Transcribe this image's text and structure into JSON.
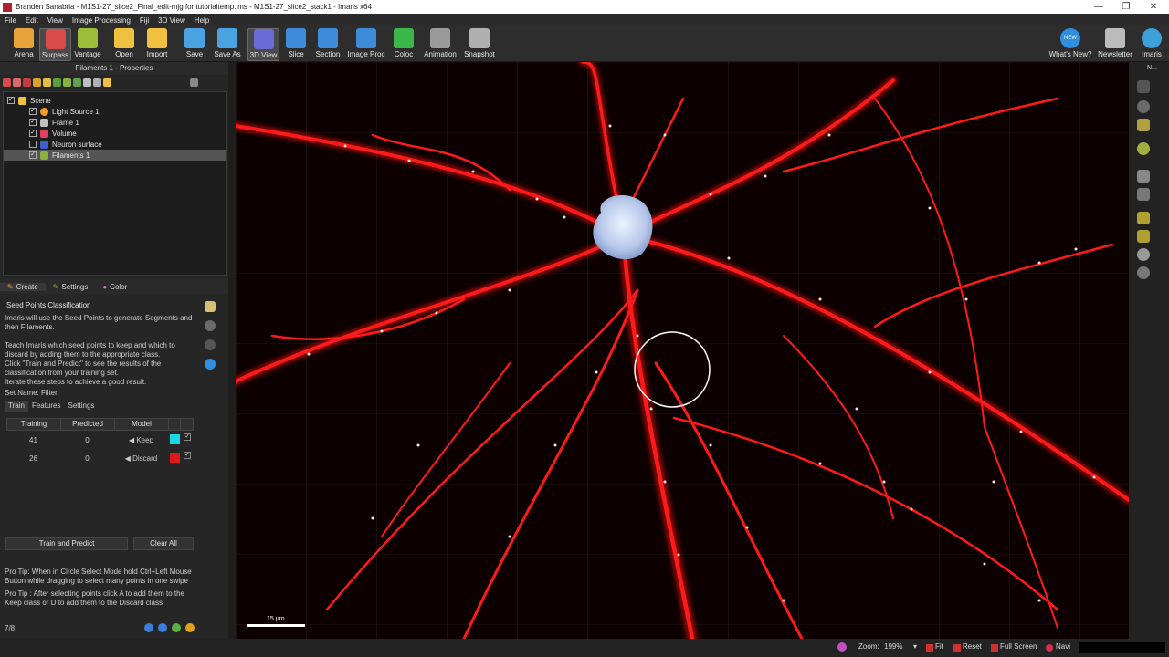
{
  "window": {
    "title": "Branden Sanabria - M1S1-27_slice2_Final_edit-mjg for tutorialtemp.ims - M1S1-27_slice2_stack1 - Imaris x64",
    "minimize": "—",
    "restore": "❐",
    "close": "✕"
  },
  "menu": [
    "File",
    "Edit",
    "View",
    "Image Processing",
    "Fiji",
    "3D View",
    "Help"
  ],
  "toolbar": {
    "left": [
      {
        "label": "Arena",
        "color": "#e8a23a"
      },
      {
        "label": "Surpass",
        "color": "#d94b4b"
      },
      {
        "label": "Vantage",
        "color": "#9bbd3a"
      },
      {
        "label": "Open",
        "color": "#f0c040"
      },
      {
        "label": "Import",
        "color": "#f0c040"
      },
      {
        "label": "Save",
        "color": "#4aa3e0"
      },
      {
        "label": "Save As",
        "color": "#4aa3e0"
      },
      {
        "label": "3D View",
        "color": "#6b6bd8"
      },
      {
        "label": "Slice",
        "color": "#3d8ad8"
      },
      {
        "label": "Section",
        "color": "#3d8ad8"
      },
      {
        "label": "Image Proc",
        "color": "#3d8ad8"
      },
      {
        "label": "Coloc",
        "color": "#3cb84a"
      },
      {
        "label": "Animation",
        "color": "#9a9a9a"
      },
      {
        "label": "Snapshot",
        "color": "#b0b0b0"
      }
    ],
    "right": [
      {
        "label": "What's New?",
        "color": "#2f8fe0"
      },
      {
        "label": "Newsletter",
        "color": "#bbbbbb"
      },
      {
        "label": "Imaris",
        "color": "#3da0d8"
      }
    ],
    "new_badge": "NEW"
  },
  "properties_panel": {
    "title": "Filaments 1 - Properties",
    "tree": [
      {
        "label": "Scene",
        "checked": true,
        "icon_color": "#f0c040",
        "indent": 0
      },
      {
        "label": "Light Source 1",
        "checked": true,
        "icon_color": "#f0a020",
        "indent": 1
      },
      {
        "label": "Frame 1",
        "checked": true,
        "icon_color": "#c0c0c0",
        "indent": 1
      },
      {
        "label": "Volume",
        "checked": true,
        "icon_color": "#e04060",
        "indent": 1
      },
      {
        "label": "Neuron surface",
        "checked": false,
        "icon_color": "#4060d0",
        "indent": 1
      },
      {
        "label": "Filaments 1",
        "checked": true,
        "icon_color": "#8ab040",
        "indent": 1,
        "selected": true
      }
    ],
    "tabs": [
      "Create",
      "Settings",
      "Color"
    ],
    "section_title": "Seed Points Classification",
    "intro": "Imaris will use the Seed Points to generate Segments and then Filaments.",
    "instructions": [
      "Teach Imaris which seed points to keep and which to",
      "discard by adding them to the appropriate class.",
      "Click \"Train and Predict\" to see the results of the",
      "classification from your training set.",
      "Iterate these steps to achieve a good result."
    ],
    "set_name": "Set Name: Filter",
    "subtabs": [
      "Train",
      "Features",
      "Settings"
    ],
    "table": {
      "headers": [
        "Training",
        "Predicted",
        "Model"
      ],
      "rows": [
        {
          "training": "41",
          "predicted": "0",
          "model": "Keep",
          "color": "#19d6e8"
        },
        {
          "training": "26",
          "predicted": "0",
          "model": "Discard",
          "color": "#e01818"
        }
      ]
    },
    "train_button": "Train and Predict",
    "clear_button": "Clear All",
    "tip1": "Pro Tip: When in Circle Select Mode hold Ctrl+Left Mouse Button while dragging to select many points in one swipe",
    "tip2": "Pro Tip : After selecting points click A to add them to the Keep class or D to add them to the Discard class",
    "step": "7/8"
  },
  "viewer": {
    "scale_label": "15 µm"
  },
  "status": {
    "zoom_label": "Zoom:",
    "zoom_value": "199%",
    "fit": "Fit",
    "reset": "Reset",
    "full_screen": "Full Screen",
    "navi": "Navi"
  },
  "right_bar_label": "N..."
}
